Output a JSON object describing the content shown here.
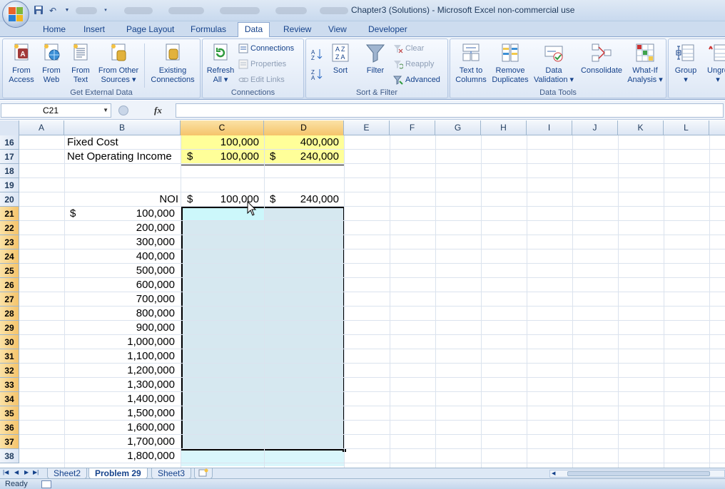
{
  "title_bar": {
    "title": "Chapter3 (Solutions)  -  Microsoft Excel non-commercial use"
  },
  "tabs": [
    "Home",
    "Insert",
    "Page Layout",
    "Formulas",
    "Data",
    "Review",
    "View",
    "Developer"
  ],
  "active_tab": "Data",
  "ribbon": {
    "get_external_data": {
      "label": "Get External Data",
      "from_access": [
        "From",
        "Access"
      ],
      "from_web": [
        "From",
        "Web"
      ],
      "from_text": [
        "From",
        "Text"
      ],
      "from_other": [
        "From Other",
        "Sources ▾"
      ],
      "existing": [
        "Existing",
        "Connections"
      ]
    },
    "connections": {
      "label": "Connections",
      "refresh": [
        "Refresh",
        "All ▾"
      ],
      "connections": "Connections",
      "properties": "Properties",
      "edit_links": "Edit Links"
    },
    "sort_filter": {
      "label": "Sort & Filter",
      "sort": "Sort",
      "filter": "Filter",
      "clear": "Clear",
      "reapply": "Reapply",
      "advanced": "Advanced"
    },
    "data_tools": {
      "label": "Data Tools",
      "text_to_columns": [
        "Text to",
        "Columns"
      ],
      "remove_duplicates": [
        "Remove",
        "Duplicates"
      ],
      "data_validation": [
        "Data",
        "Validation ▾"
      ],
      "consolidate": "Consolidate",
      "what_if": [
        "What-If",
        "Analysis ▾"
      ]
    },
    "outline": {
      "group": "Group",
      "ungroup": "Ungro"
    }
  },
  "formula_bar": {
    "name_box": "C21",
    "fx": "fx",
    "formula": ""
  },
  "columns": [
    "A",
    "B",
    "C",
    "D",
    "E",
    "F",
    "G",
    "H",
    "I",
    "J",
    "K",
    "L"
  ],
  "rows": [
    "16",
    "17",
    "18",
    "19",
    "20",
    "21",
    "22",
    "23",
    "24",
    "25",
    "26",
    "27",
    "28",
    "29",
    "30",
    "31",
    "32",
    "33",
    "34",
    "35",
    "36",
    "37",
    "38"
  ],
  "cells": {
    "b16": "Fixed Cost",
    "c16": "100,000",
    "d16": "400,000",
    "b17": "Net Operating Income",
    "c17_sym": "$",
    "c17": "100,000",
    "d17_sym": "$",
    "d17": "240,000",
    "b20": "NOI",
    "c20_sym": "$",
    "c20": "100,000",
    "d20_sym": "$",
    "d20": "240,000",
    "a21": "$",
    "sales": [
      "100,000",
      "200,000",
      "300,000",
      "400,000",
      "500,000",
      "600,000",
      "700,000",
      "800,000",
      "900,000",
      "1,000,000",
      "1,100,000",
      "1,200,000",
      "1,300,000",
      "1,400,000",
      "1,500,000",
      "1,600,000",
      "1,700,000",
      "1,800,000"
    ]
  },
  "sheet_tabs": [
    "Sheet2",
    "Problem 29",
    "Sheet3"
  ],
  "active_sheet": "Problem 29",
  "status": "Ready"
}
